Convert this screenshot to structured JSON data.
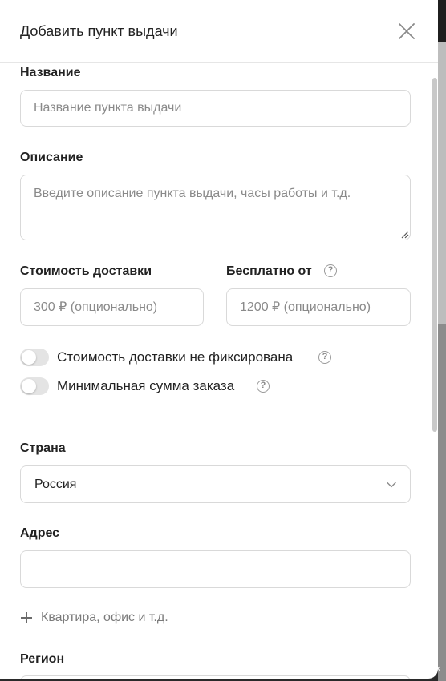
{
  "dialog": {
    "title": "Добавить пункт выдачи"
  },
  "form": {
    "name": {
      "label": "Название",
      "placeholder": "Название пункта выдачи",
      "value": ""
    },
    "description": {
      "label": "Описание",
      "placeholder": "Введите описание пункта выдачи, часы работы и т.д.",
      "value": ""
    },
    "delivery_cost": {
      "label": "Стоимость доставки",
      "placeholder": "300 ₽ (опционально)",
      "value": ""
    },
    "free_from": {
      "label": "Бесплатно от",
      "placeholder": "1200 ₽ (опционально)",
      "value": ""
    },
    "toggles": [
      {
        "label": "Стоимость доставки не фиксирована",
        "on": false
      },
      {
        "label": "Минимальная сумма заказа",
        "on": false
      }
    ],
    "country": {
      "label": "Страна",
      "selected": "Россия"
    },
    "address": {
      "label": "Адрес",
      "placeholder": "",
      "value": ""
    },
    "add_apartment": "Квартира, офис и т.д.",
    "region": {
      "label": "Регион"
    }
  },
  "icons": {
    "close": "close-icon",
    "help": "help-circle-icon",
    "chevron": "chevron-down-icon",
    "plus": "plus-icon"
  },
  "colors": {
    "border": "#d9d9d9",
    "toggle_off": "#e4e4e4",
    "muted_text": "#8a8a8a"
  }
}
